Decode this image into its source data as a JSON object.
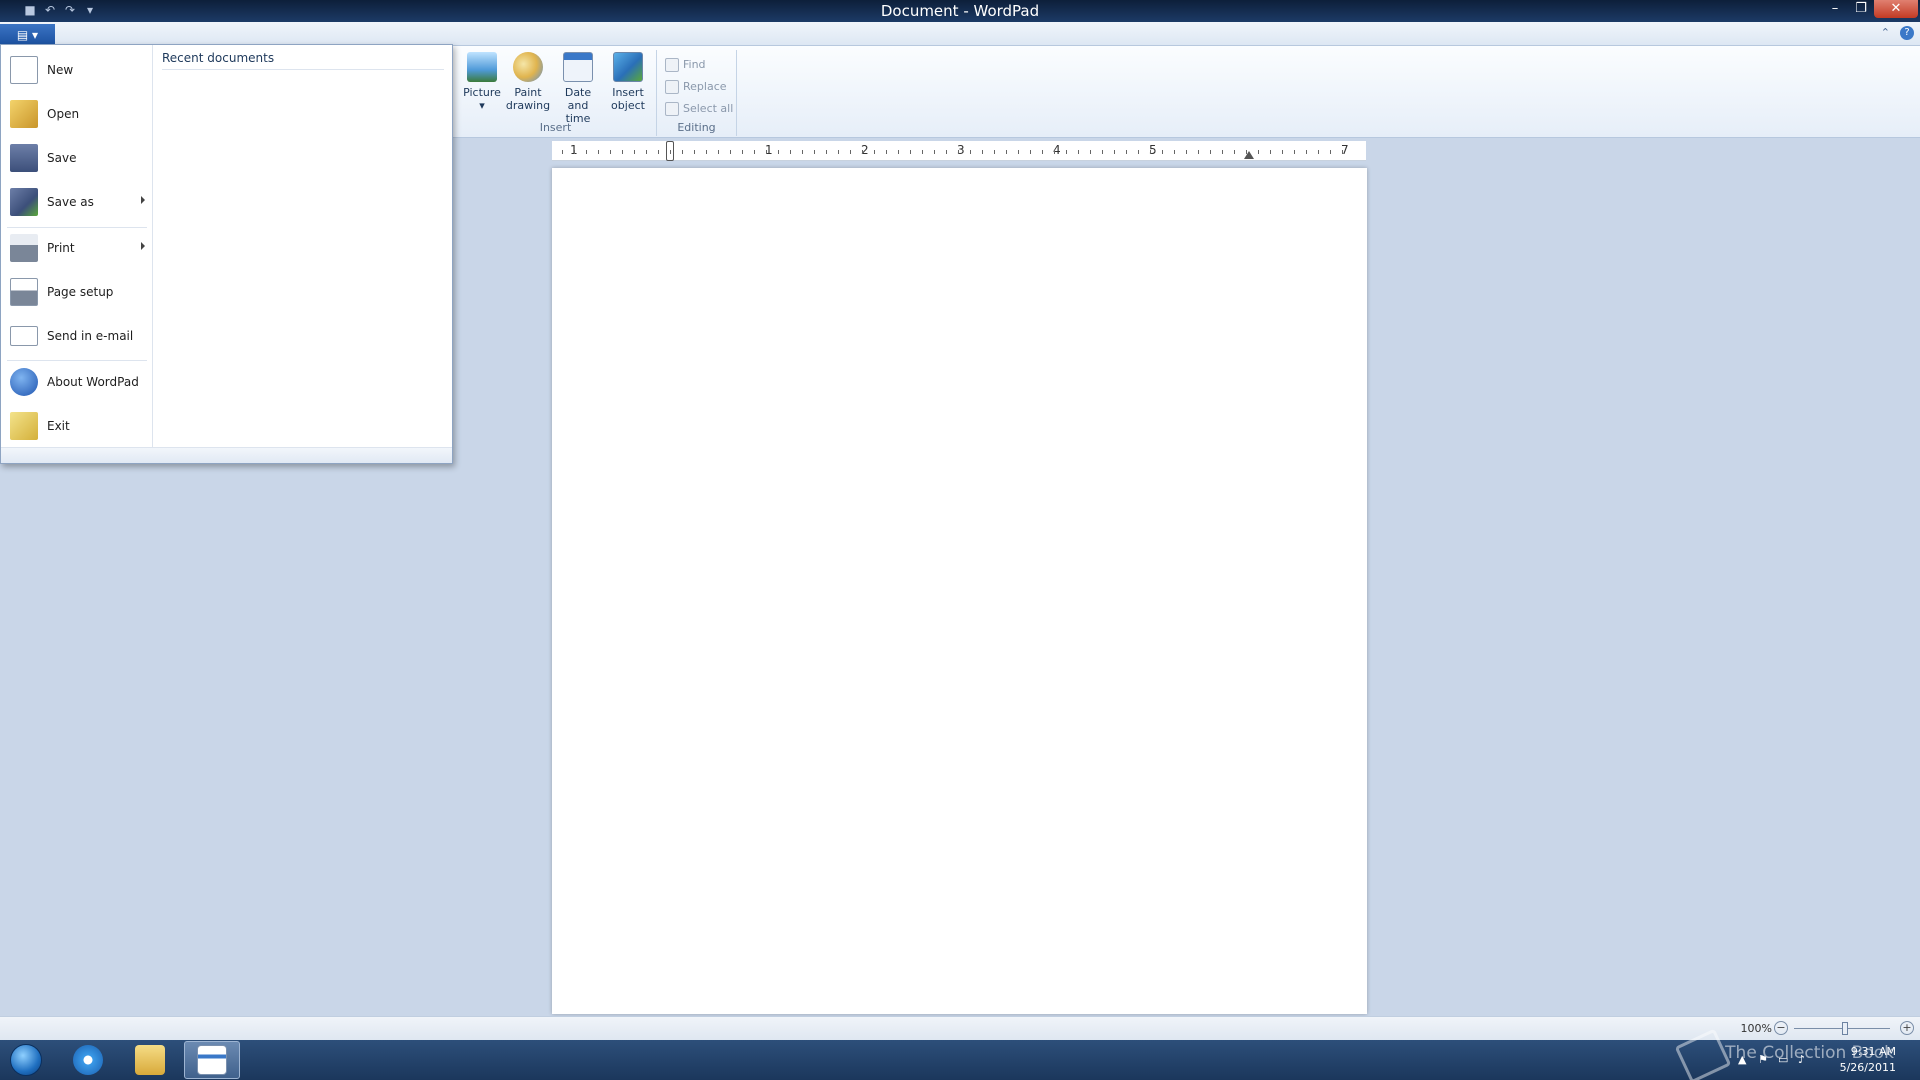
{
  "window": {
    "title": "Document - WordPad",
    "minimize_glyph": "–",
    "maximize_glyph": "❐",
    "close_glyph": "✕"
  },
  "quick_access": {
    "save_glyph": "■",
    "undo_glyph": "↶",
    "redo_glyph": "↷",
    "customize_glyph": "▾"
  },
  "ribbon_tabs": {
    "app_button_glyph": "▤ ▾",
    "minimize_ribbon_glyph": "⌃",
    "help_glyph": "?"
  },
  "ribbon": {
    "insert_group": {
      "label": "Insert",
      "buttons": [
        {
          "line1": "Picture",
          "line2": "▾",
          "icon": "picture-icon"
        },
        {
          "line1": "Paint",
          "line2": "drawing",
          "icon": "paint-icon"
        },
        {
          "line1": "Date and",
          "line2": "time",
          "icon": "calendar-icon"
        },
        {
          "line1": "Insert",
          "line2": "object",
          "icon": "object-icon"
        }
      ]
    },
    "editing_group": {
      "label": "Editing",
      "buttons": [
        {
          "label": "Find",
          "icon": "binoculars-icon"
        },
        {
          "label": "Replace",
          "icon": "replace-icon"
        },
        {
          "label": "Select all",
          "icon": "select-all-icon"
        }
      ]
    }
  },
  "ruler": {
    "labels": [
      "1",
      "1",
      "2",
      "3",
      "4",
      "5",
      "7"
    ]
  },
  "app_menu": {
    "items": [
      {
        "label": "New",
        "icon": "new-document-icon",
        "submenu": false
      },
      {
        "label": "Open",
        "icon": "open-folder-icon",
        "submenu": false
      },
      {
        "label": "Save",
        "icon": "save-disk-icon",
        "submenu": false
      },
      {
        "label": "Save as",
        "icon": "save-as-icon",
        "submenu": true
      },
      {
        "label": "Print",
        "icon": "printer-icon",
        "submenu": true
      },
      {
        "label": "Page setup",
        "icon": "page-setup-icon",
        "submenu": false
      },
      {
        "label": "Send in e-mail",
        "icon": "email-icon",
        "submenu": false
      },
      {
        "label": "About WordPad",
        "icon": "info-icon",
        "submenu": false
      },
      {
        "label": "Exit",
        "icon": "exit-icon",
        "submenu": false
      }
    ],
    "recent_header": "Recent documents"
  },
  "status_bar": {
    "zoom": "100%",
    "zoom_out_glyph": "−",
    "zoom_in_glyph": "+"
  },
  "taskbar": {
    "time": "9:31 AM",
    "date": "5/26/2011",
    "watermark": "The Collection Book",
    "tray_glyphs": [
      "▲",
      "⚑",
      "▭",
      "♪"
    ]
  },
  "colors": {
    "accent": "#1a4f9e",
    "ribbon_bg": "#e6eef8",
    "workspace": "#c9d6e8",
    "taskbar": "#1b375c"
  }
}
